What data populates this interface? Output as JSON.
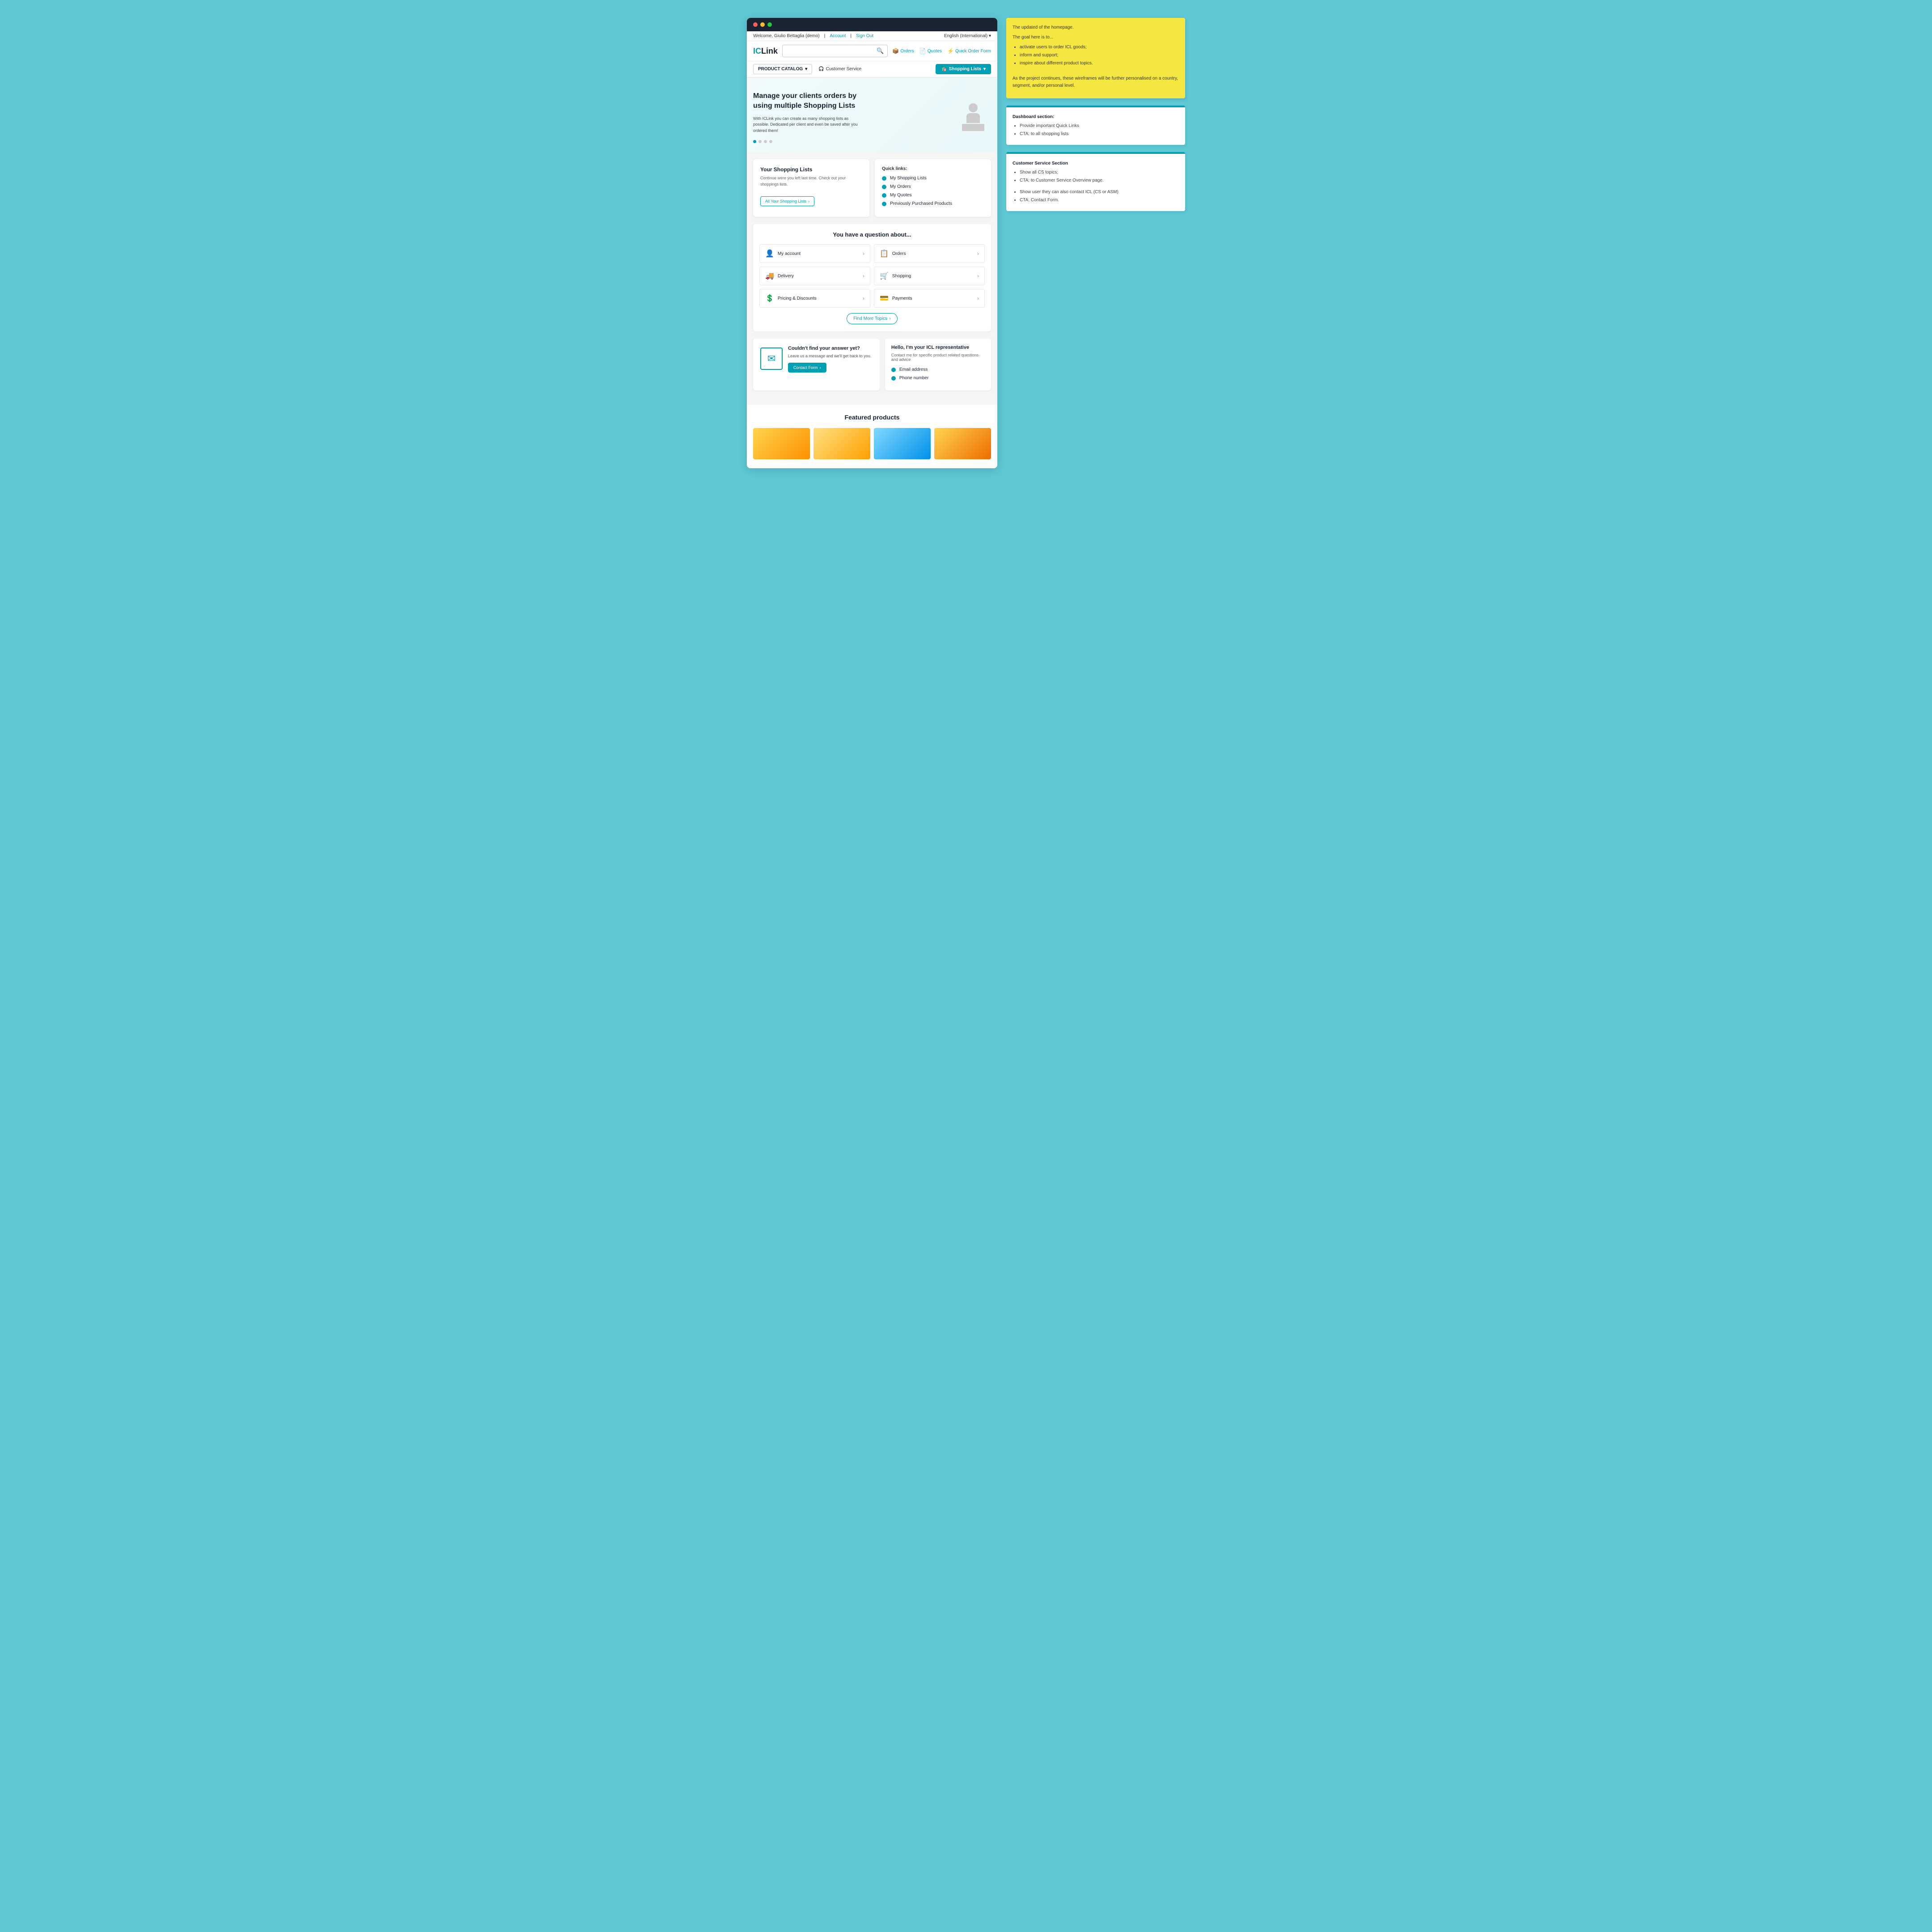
{
  "topbar": {
    "welcome_text": "Welcome, Giulio Bettaglia (demo)",
    "account_label": "Account",
    "signout_label": "Sign Out",
    "language_label": "English (International)"
  },
  "header": {
    "logo_text": "IC",
    "logo_text2": "Link",
    "orders_label": "Orders",
    "quotes_label": "Quotes",
    "quick_order_label": "Quick Order Form",
    "search_placeholder": ""
  },
  "navbar": {
    "product_catalog_label": "PRODUCT CATALOG",
    "customer_service_label": "Customer Service",
    "shopping_lists_label": "Shopping Lists"
  },
  "hero": {
    "title": "Manage your clients orders by using multiple Shopping Lists",
    "subtitle": "With ICLink you can create as many shopping lists as possible. Dedicated per client and even be saved after you ordered them!"
  },
  "dashboard": {
    "shopping_lists_title": "Your Shopping Lists",
    "shopping_lists_subtitle": "Continue were you left last time. Check out your shoppings lists.",
    "all_lists_btn": "All Your Shopping Lists",
    "quick_links_title": "Quick links:",
    "quick_links": [
      {
        "label": "My Shopping Lists"
      },
      {
        "label": "My Orders"
      },
      {
        "label": "My Quotes"
      },
      {
        "label": "Previously Purchased Products"
      }
    ]
  },
  "customer_service": {
    "heading": "You have a question about...",
    "items": [
      {
        "icon": "👤",
        "label": "My account"
      },
      {
        "icon": "📋",
        "label": "Orders"
      },
      {
        "icon": "🚚",
        "label": "Delivery"
      },
      {
        "icon": "🛒",
        "label": "Shopping"
      },
      {
        "icon": "💲",
        "label": "Pricing & Discounts"
      },
      {
        "icon": "💳",
        "label": "Payments"
      }
    ],
    "find_more_label": "Find More Topics"
  },
  "contact": {
    "form_title": "Couldn't find your answer yet?",
    "form_subtitle": "Leave us a message and we'll get back to you.",
    "form_btn": "Contact Form",
    "rep_title": "Hello, I'm your ICL representative",
    "rep_subtitle": "Contact me for specific product related questions and advice",
    "rep_email": "Email address",
    "rep_phone": "Phone number"
  },
  "featured": {
    "title": "Featured products"
  },
  "notes": {
    "note1": {
      "line1": "The updated of the homepage.",
      "line2": "The goal here is to...",
      "items": [
        "activate users to order ICL goods;",
        "inform and support;",
        "inspire about different product topics."
      ],
      "line3": "As the project continues, these wireframes will be further personalised on a country, segment, and/or personal level."
    },
    "note2": {
      "title": "Dashboard section:",
      "items": [
        "Provide important Quick Links",
        "CTA:  to all shopping lists"
      ]
    },
    "note3": {
      "title": "Customer Service Section",
      "items": [
        "Show all CS topics;",
        "CTA: to Customer Service Overview page.",
        "",
        "Show user they can also contact ICL (CS or ASM)",
        "CTA: Contact Form."
      ]
    }
  }
}
